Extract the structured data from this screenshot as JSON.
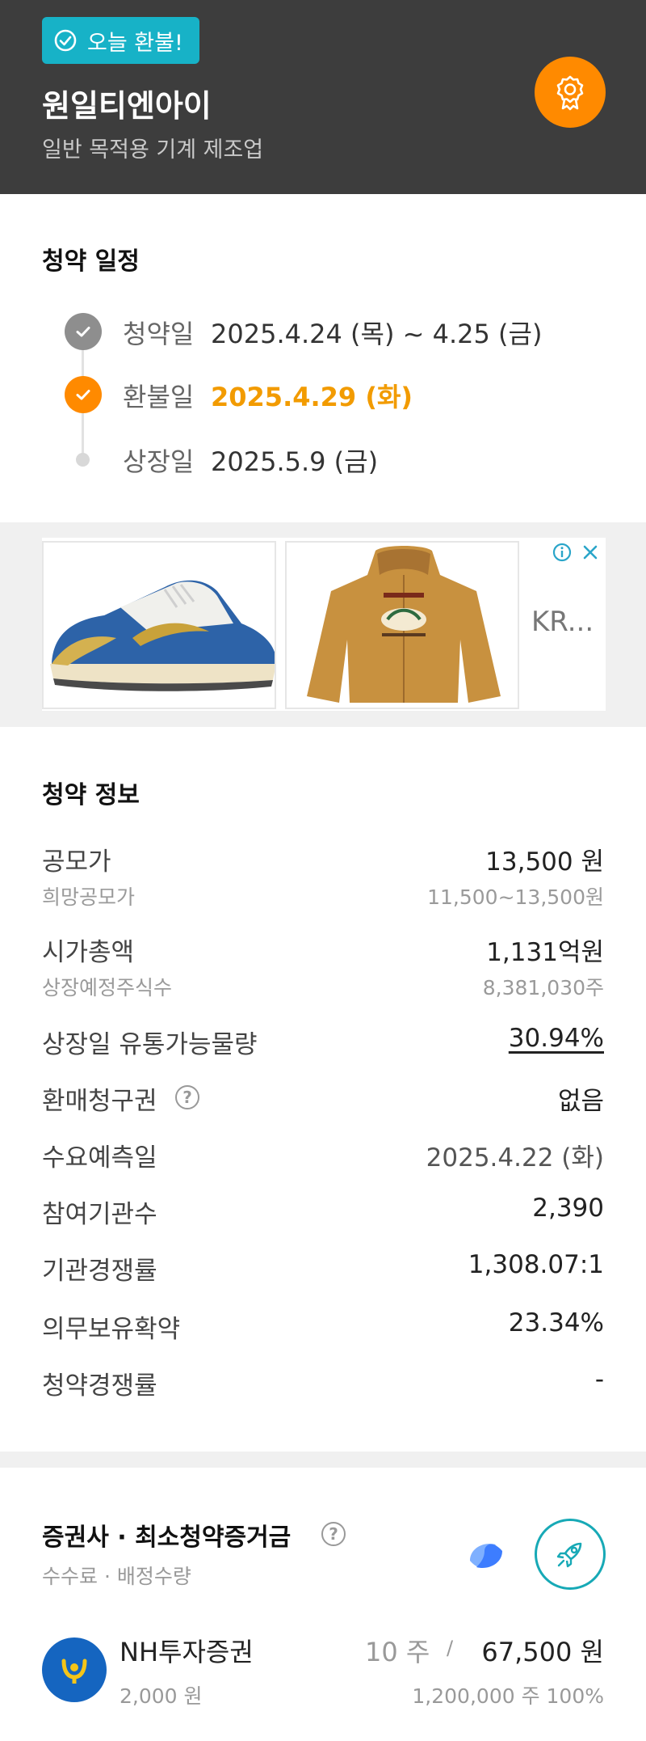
{
  "header": {
    "badge_label": "오늘 환불!",
    "company_name": "원일티엔아이",
    "industry": "일반 목적용 기계 제조업"
  },
  "schedule": {
    "title": "청약 일정",
    "items": [
      {
        "label": "청약일",
        "value": "2025.4.24 (목) ~ 4.25 (금)",
        "state": "done"
      },
      {
        "label": "환불일",
        "value": "2025.4.29 (화)",
        "state": "current"
      },
      {
        "label": "상장일",
        "value": "2025.5.9 (금)",
        "state": "upcoming"
      }
    ]
  },
  "ad": {
    "more_label": "KR..."
  },
  "subscription_info": {
    "title": "청약 정보",
    "offering_price": {
      "label": "공모가",
      "value": "13,500 원"
    },
    "desired_price": {
      "label": "희망공모가",
      "value": "11,500~13,500원"
    },
    "market_cap": {
      "label": "시가총액",
      "value": "1,131억원"
    },
    "shares_listed": {
      "label": "상장예정주식수",
      "value": "8,381,030주"
    },
    "float_ratio": {
      "label": "상장일 유통가능물량",
      "value": "30.94%"
    },
    "put_back_option": {
      "label": "환매청구권",
      "value": "없음"
    },
    "forecast_date": {
      "label": "수요예측일",
      "value": "2025.4.22 (화)"
    },
    "institutions": {
      "label": "참여기관수",
      "value": "2,390"
    },
    "inst_competition": {
      "label": "기관경쟁률",
      "value": "1,308.07:1"
    },
    "lockup": {
      "label": "의무보유확약",
      "value": "23.34%"
    },
    "sub_competition": {
      "label": "청약경쟁률",
      "value": "-"
    }
  },
  "brokers": {
    "title": "증권사 · 최소청약증거금",
    "subtitle": "수수료 · 배정수량",
    "items": [
      {
        "name": "NH투자증권",
        "fee": "2,000 원",
        "min_shares": "10 주",
        "separator": "/",
        "min_deposit": "67,500 원",
        "allocation": "1,200,000 주  100%"
      }
    ]
  },
  "colors": {
    "header_bg": "#3d3d3d",
    "badge": "#17b2c7",
    "accent_orange": "#ff8a00",
    "highlight_text": "#f29b00"
  }
}
